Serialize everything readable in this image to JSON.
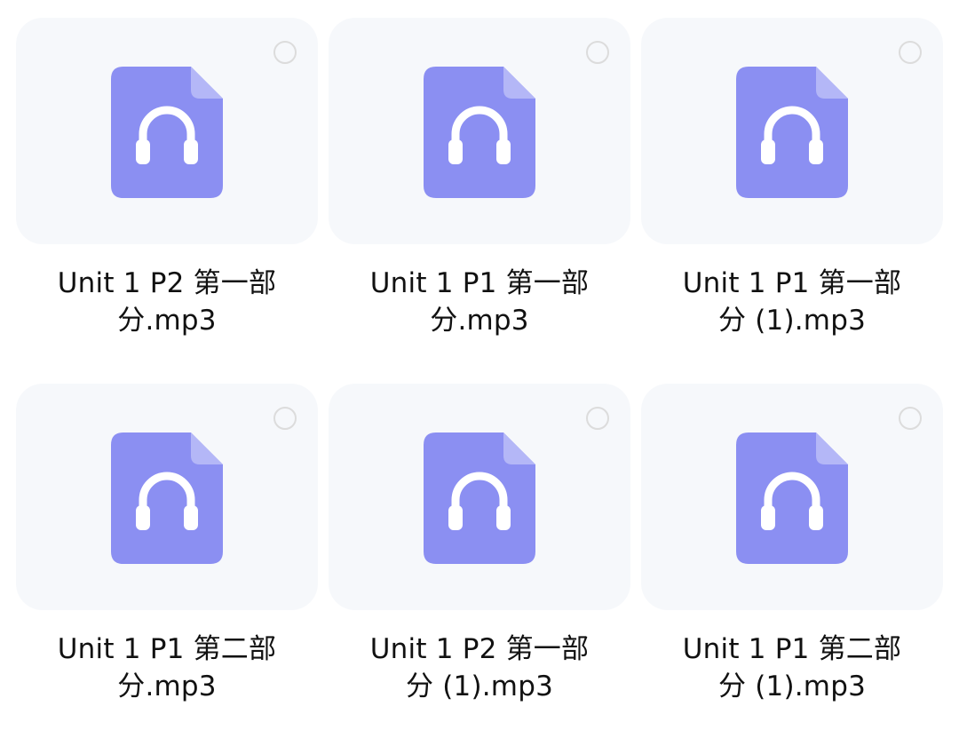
{
  "files": [
    {
      "line1": "Unit 1 P2 第一部",
      "line2": "分.mp3",
      "selected": false,
      "icon": "audio-file-icon"
    },
    {
      "line1": "Unit 1 P1 第一部",
      "line2": "分.mp3",
      "selected": false,
      "icon": "audio-file-icon"
    },
    {
      "line1": "Unit 1 P1 第一部",
      "line2": "分 (1).mp3",
      "selected": false,
      "icon": "audio-file-icon"
    },
    {
      "line1": "Unit 1 P1 第二部",
      "line2": "分.mp3",
      "selected": false,
      "icon": "audio-file-icon"
    },
    {
      "line1": "Unit 1 P2 第一部",
      "line2": "分 (1).mp3",
      "selected": false,
      "icon": "audio-file-icon"
    },
    {
      "line1": "Unit 1 P1 第二部",
      "line2": "分 (1).mp3",
      "selected": false,
      "icon": "audio-file-icon"
    }
  ],
  "colors": {
    "card_background": "#f6f8fb",
    "icon_fill": "#8b8ff2",
    "icon_fold": "#b4b7f7",
    "headphone": "#ffffff",
    "select_circle_border": "#dcdcdc",
    "text": "#111111"
  }
}
